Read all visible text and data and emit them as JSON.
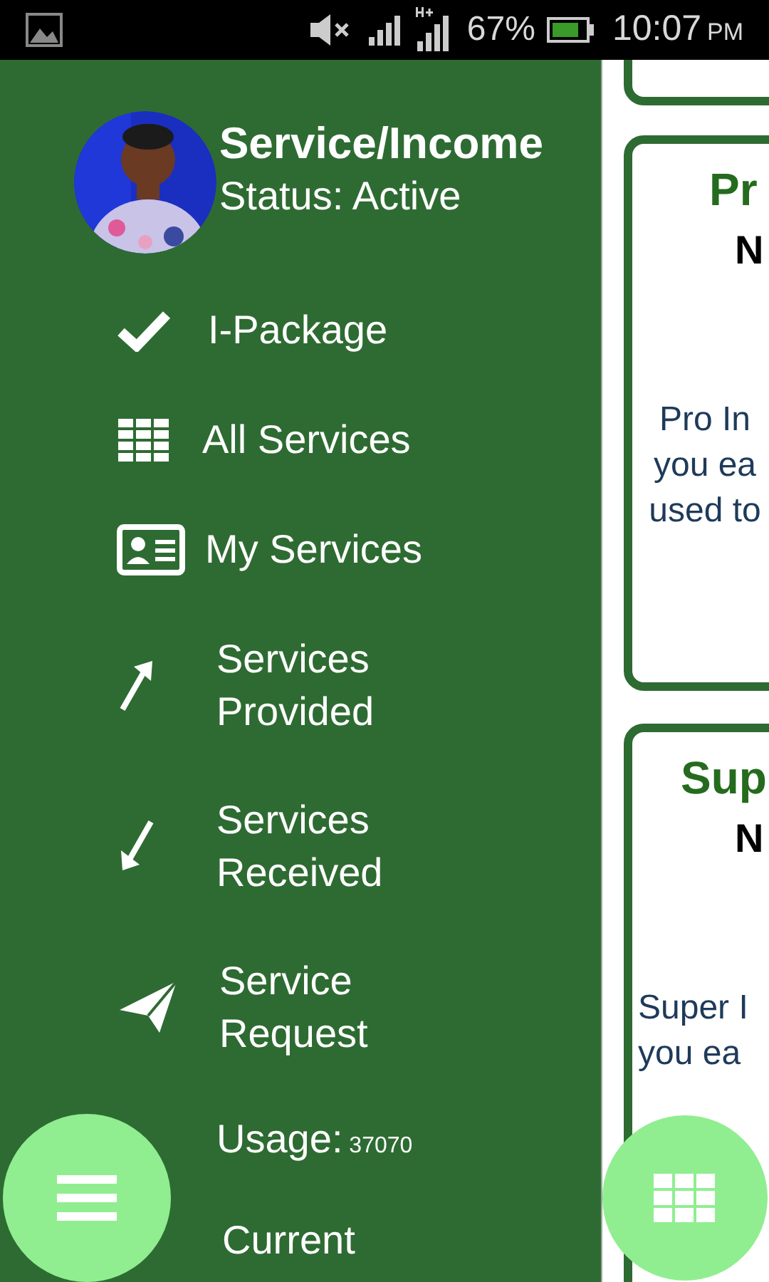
{
  "status_bar": {
    "battery": "67%",
    "time": "10:07",
    "meridiem": "PM"
  },
  "drawer": {
    "title": "Service/Income",
    "status": "Status: Active",
    "items": [
      {
        "label": "I-Package"
      },
      {
        "label": "All Services"
      },
      {
        "label": "My Services"
      },
      {
        "label": "Services Provided"
      },
      {
        "label": "Services Received"
      },
      {
        "label": "Service Request"
      },
      {
        "label": "Usage:",
        "value": "37070"
      },
      {
        "label": "Current"
      }
    ]
  },
  "cards": [
    {
      "title": "Pr",
      "subtitle": "N",
      "lines": [
        "Pro In",
        "you ea",
        "used to"
      ]
    },
    {
      "title": "Sup",
      "subtitle": "N",
      "lines": [
        "Super I",
        "you ea"
      ]
    }
  ]
}
